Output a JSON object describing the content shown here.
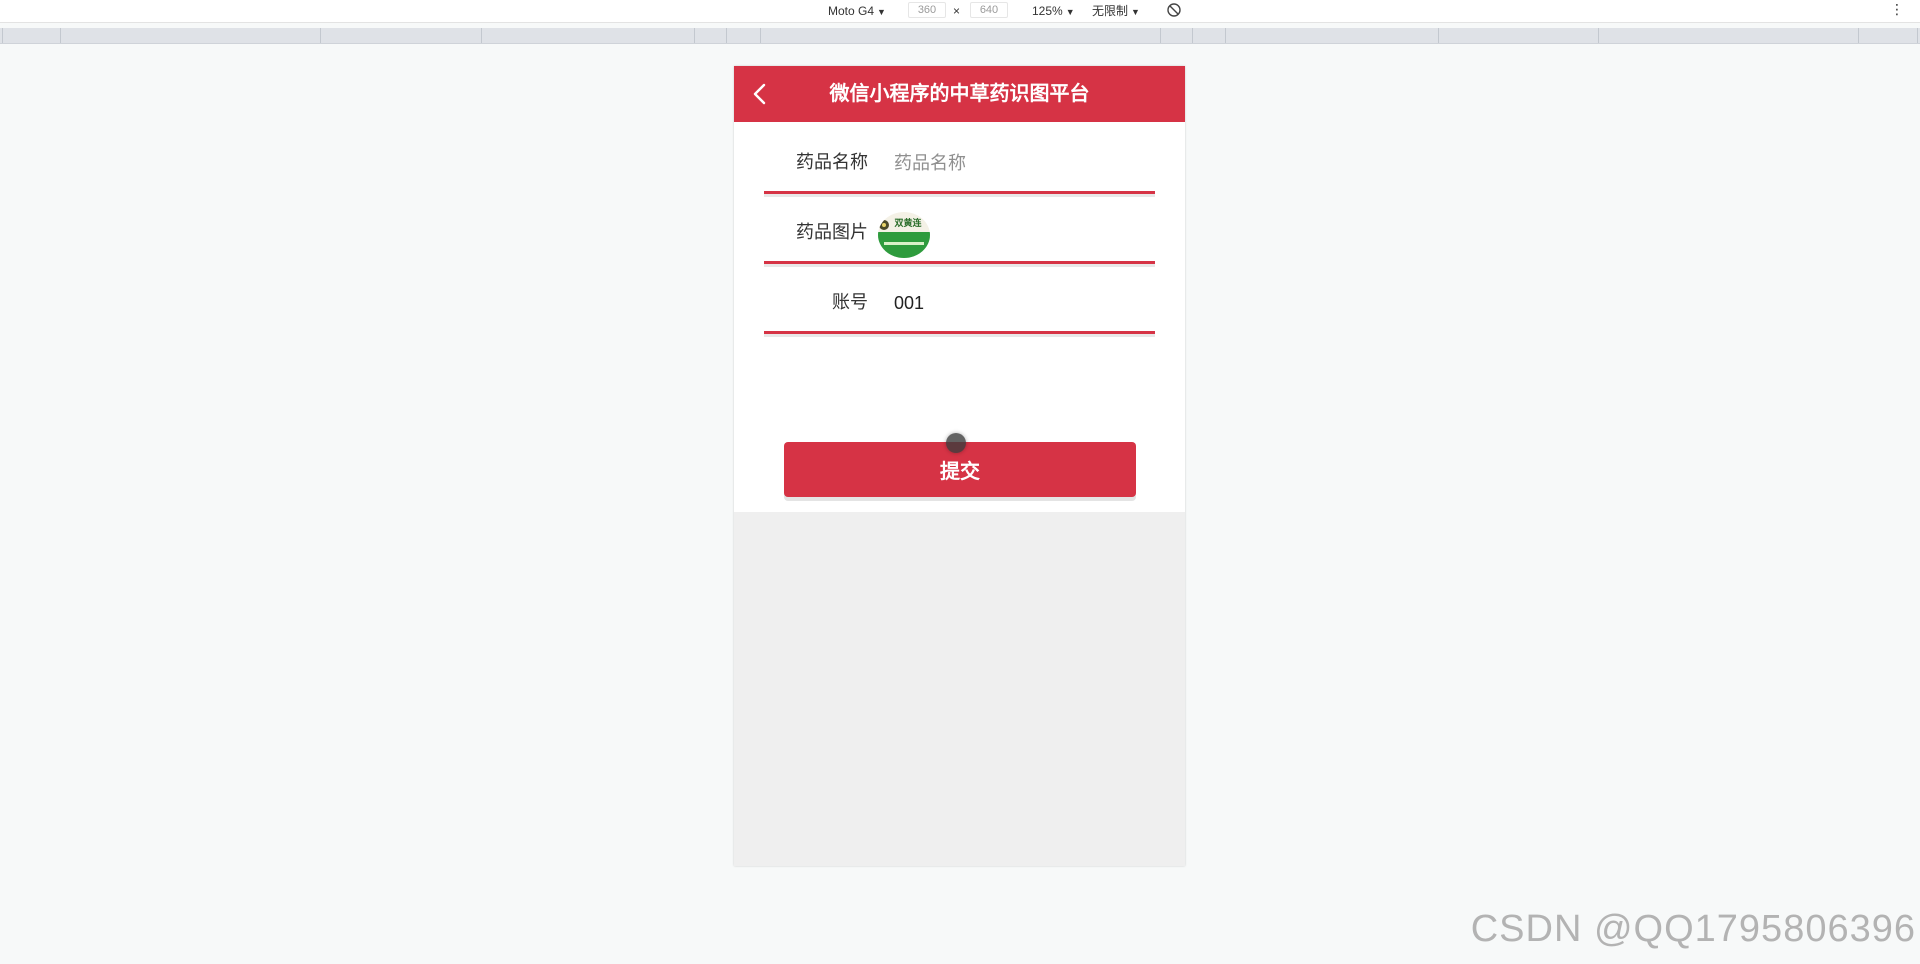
{
  "devtools": {
    "device": "Moto G4",
    "width_value": "360",
    "height_value": "640",
    "times": "×",
    "zoom": "125%",
    "throttle": "无限制",
    "more": "⋮"
  },
  "app": {
    "title": "微信小程序的中草药识图平台",
    "fields": [
      {
        "label": "药品名称",
        "placeholder": "药品名称",
        "value": ""
      },
      {
        "label": "药品图片"
      },
      {
        "label": "账号",
        "placeholder": "",
        "value": "001"
      }
    ],
    "submit_label": "提交",
    "thumbnail_text": "双黄连"
  },
  "accent_color": "#d63345",
  "watermark": "CSDN @QQ1795806396",
  "icons": [
    "chevron-left-icon",
    "rotate-icon",
    "more-icon"
  ]
}
